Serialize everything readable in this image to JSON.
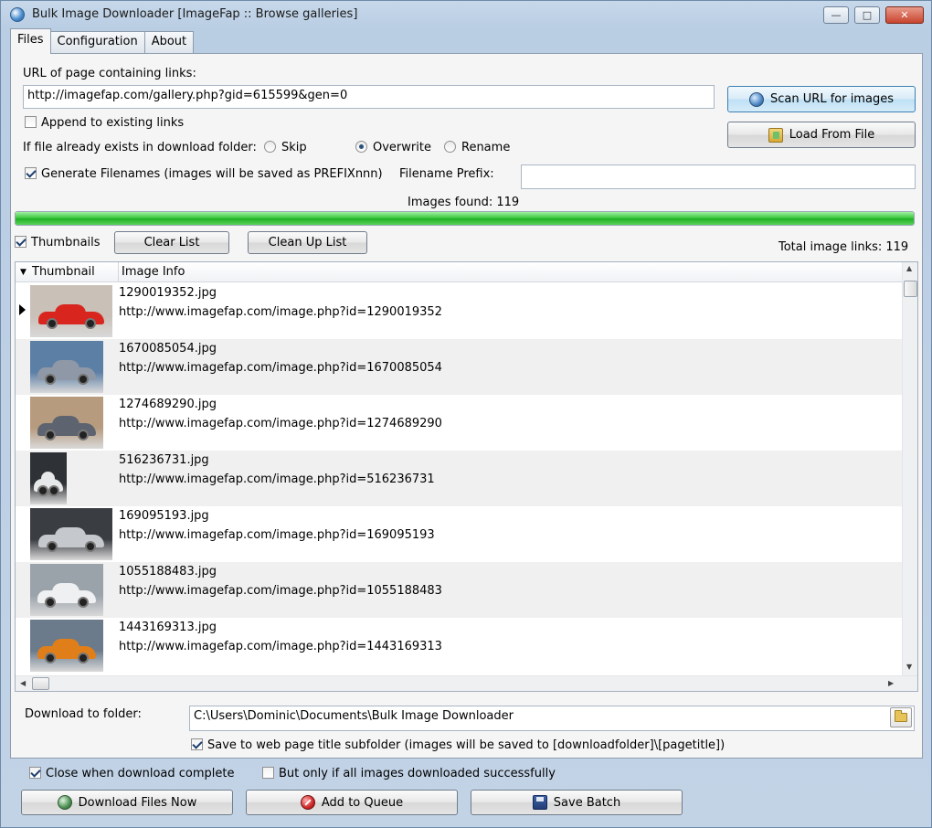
{
  "window": {
    "title": "Bulk Image Downloader [ImageFap :: Browse galleries]"
  },
  "tabs": [
    {
      "label": "Files",
      "active": true
    },
    {
      "label": "Configuration",
      "active": false
    },
    {
      "label": "About",
      "active": false
    }
  ],
  "url": {
    "label": "URL of page containing links:",
    "value": "http://imagefap.com/gallery.php?gid=615599&gen=0"
  },
  "buttons": {
    "scan": "Scan URL for images",
    "load": "Load From File",
    "clear_list": "Clear List",
    "clean_up_list": "Clean Up List",
    "download_now": "Download Files Now",
    "add_to_queue": "Add to Queue",
    "save_batch": "Save Batch"
  },
  "options": {
    "append": {
      "label": "Append to existing links",
      "checked": false
    },
    "file_exists": {
      "label": "If file already exists in download folder:",
      "choices": [
        "Skip",
        "Overwrite",
        "Rename"
      ],
      "selected": "Overwrite"
    },
    "generate_filenames": {
      "label": "Generate Filenames (images will be saved as PREFIXnnn)",
      "checked": true
    },
    "filename_prefix": {
      "label": "Filename Prefix:",
      "value": ""
    }
  },
  "status": {
    "images_found": "Images found: 119",
    "progress": 1.0,
    "total_links": "Total image links: 119"
  },
  "list": {
    "thumbnails": {
      "label": "Thumbnails",
      "checked": true
    },
    "columns": [
      "Thumbnail",
      "Image Info"
    ],
    "rows": [
      {
        "name": "1290019352.jpg",
        "url": "http://www.imagefap.com/image.php?id=1290019352",
        "color": "#d8261e",
        "bg": "#c9c0b8"
      },
      {
        "name": "1670085054.jpg",
        "url": "http://www.imagefap.com/image.php?id=1670085054",
        "color": "#8f98a6",
        "bg": "#5c7fa6"
      },
      {
        "name": "1274689290.jpg",
        "url": "http://www.imagefap.com/image.php?id=1274689290",
        "color": "#5d6470",
        "bg": "#b79b7e"
      },
      {
        "name": "516236731.jpg",
        "url": "http://www.imagefap.com/image.php?id=516236731",
        "color": "#e6e8ea",
        "bg": "#2e3135"
      },
      {
        "name": "169095193.jpg",
        "url": "http://www.imagefap.com/image.php?id=169095193",
        "color": "#c5c8cc",
        "bg": "#3a3d42"
      },
      {
        "name": "1055188483.jpg",
        "url": "http://www.imagefap.com/image.php?id=1055188483",
        "color": "#eef0f2",
        "bg": "#9aa2aa"
      },
      {
        "name": "1443169313.jpg",
        "url": "http://www.imagefap.com/image.php?id=1443169313",
        "color": "#e07f1a",
        "bg": "#6b7b8c"
      }
    ]
  },
  "download": {
    "label": "Download to folder:",
    "path": "C:\\Users\\Dominic\\Documents\\Bulk Image Downloader",
    "subfolder": {
      "label": "Save to web page title subfolder (images will be saved to [downloadfolder]\\[pagetitle])",
      "checked": true
    }
  },
  "footer": {
    "close_when_done": {
      "label": "Close when download complete",
      "checked": true
    },
    "only_if_success": {
      "label": "But only if all images downloaded successfully",
      "checked": false
    }
  },
  "colors": {
    "progress": "#37c43a",
    "accent": "#3c7fb1"
  },
  "icons": {
    "app": "globe-icon",
    "scan": "globe-icon",
    "load": "folder-open-icon",
    "download": "green-globe-icon",
    "queue": "stop-icon",
    "save": "disk-icon",
    "browse": "folder-icon"
  }
}
